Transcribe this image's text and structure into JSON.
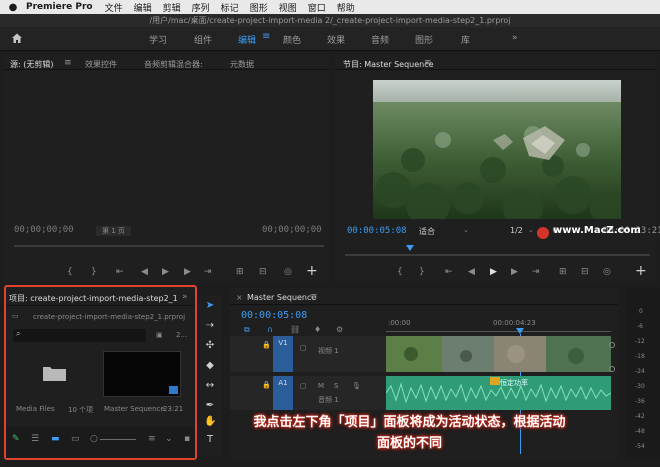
{
  "menubar": {
    "apple": "",
    "app": "Premiere Pro",
    "items": [
      "文件",
      "编辑",
      "剪辑",
      "序列",
      "标记",
      "图形",
      "视图",
      "窗口",
      "帮助"
    ]
  },
  "titlebar": {
    "path": "/用户/mac/桌面/create-project-import-media 2/_create-project-import-media-step2_1.prproj"
  },
  "workspaces": {
    "items": [
      "学习",
      "组件",
      "编辑",
      "颜色",
      "效果",
      "音频",
      "图形",
      "库"
    ],
    "active": "编辑",
    "more": "»"
  },
  "source_panel": {
    "tabs": [
      "源: (无剪辑)",
      "效果控件",
      "音频剪辑混合器:",
      "元数据"
    ],
    "timecode_left": "00;00;00;00",
    "page_label": "第 1 页",
    "timecode_right": "00;00;00;00"
  },
  "program_panel": {
    "title": "节目: Master Sequence",
    "timecode": "00:00:05:08",
    "fit": "适合",
    "resolution": "1/2",
    "duration_partial": "00:00:23:21"
  },
  "project_panel": {
    "tab": "项目: create-project-import-media-step2_1",
    "file": "create-project-import-media-step2_1.prproj",
    "count": "2...",
    "items": [
      {
        "name": "Media Files",
        "meta": "10 个项"
      },
      {
        "name": "Master Sequence",
        "meta": "23:21"
      }
    ]
  },
  "timeline": {
    "tab": "Master Sequence",
    "timecode": "00:00:05:08",
    "ruler": [
      ":00:00",
      "00:00:04:23"
    ],
    "tracks": [
      {
        "id": "V1",
        "name": "视频 1"
      },
      {
        "id": "A1",
        "name": "音频 1"
      }
    ],
    "clip_label": "恒定功率",
    "meter_labels": [
      "0",
      "-6",
      "-12",
      "-18",
      "-24",
      "-30",
      "-36",
      "-42",
      "-48",
      "-54"
    ]
  },
  "watermark": "www.MacZ.com",
  "overlay": {
    "line1": "我点击左下角「项目」面板将成为活动状态，根据活动",
    "line2": "面板的不同"
  },
  "colors": {
    "accent": "#3d9bf3",
    "highlight": "#e0442f",
    "audio_clip": "#3ec49a",
    "video_track": "#2a5d9a"
  }
}
